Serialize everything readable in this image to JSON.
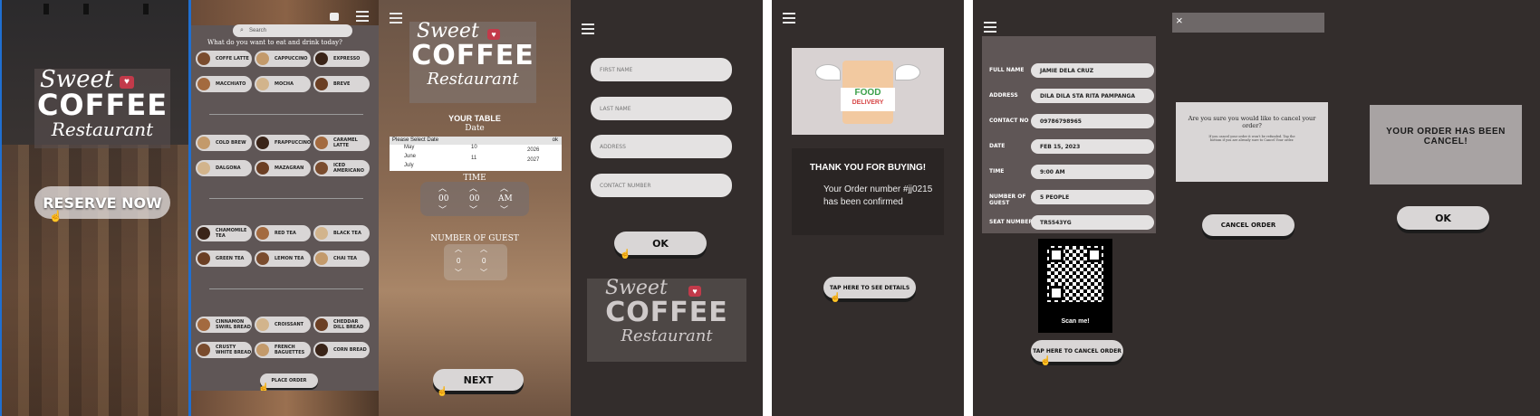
{
  "brand": {
    "script_top": "Sweet",
    "main": "COFFEE",
    "script_bottom": "Restaurant"
  },
  "screen1": {
    "reserve_label": "RESERVE NOW"
  },
  "screen2": {
    "search_placeholder": "Search",
    "prompt": "What do you want to eat and drink today?",
    "hot_drinks": [
      "COFFE LATTE",
      "CAPPUCCINO",
      "EXPRESSO",
      "MACCHIATO",
      "MOCHA",
      "BREVE"
    ],
    "cold_drinks": [
      "COLD BREW",
      "FRAPPUCCINO",
      "CARAMEL LATTE",
      "DALGONA",
      "MAZAGRAN",
      "ICED AMERICANO"
    ],
    "teas": [
      "CHAMOMILE TEA",
      "RED TEA",
      "BLACK TEA",
      "GREEN TEA",
      "LEMON TEA",
      "CHAI TEA"
    ],
    "breads": [
      "CINNAMON SWIRL BREAD",
      "CROISSANT",
      "CHEDDAR DILL BREAD",
      "CRUSTY WHITE BREAD",
      "FRENCH BAGUETTES",
      "CORN BREAD"
    ],
    "place_order": "PLACE ORDER"
  },
  "screen3": {
    "your_table": "YOUR TABLE",
    "date_label": "Date",
    "date_header": "Please Select Date",
    "date_ok": "ok",
    "months": [
      "May",
      "June",
      "July"
    ],
    "days": [
      "10",
      "11"
    ],
    "years": [
      "2026",
      "2027"
    ],
    "time_label": "TIME",
    "time_values": [
      "00",
      "00",
      "AM"
    ],
    "guest_label": "NUMBER OF GUEST",
    "guest_values": [
      "0",
      "0"
    ],
    "next_label": "NEXT"
  },
  "screen4": {
    "first_name": "FIRST NAME",
    "last_name": "LAST NAME",
    "address": "ADDRESS",
    "contact": "CONTACT NUMBER",
    "ok_label": "OK"
  },
  "screen5": {
    "badge_line1": "FOOD",
    "badge_line2": "DELIVERY",
    "thanks": "THANK YOU FOR BUYING!",
    "order_line1": "Your Order number #jj0215",
    "order_line2": "has been confirmed",
    "details_button": "TAP HERE TO SEE DETAILS"
  },
  "screen6": {
    "rows": [
      {
        "label": "FULL NAME",
        "value": "JAMIE DELA CRUZ"
      },
      {
        "label": "ADDRESS",
        "value": "DILA DILA STA RITA PAMPANGA"
      },
      {
        "label": "CONTACT NO",
        "value": "09786798965"
      },
      {
        "label": "DATE",
        "value": "FEB 15, 2023"
      },
      {
        "label": "TIME",
        "value": "9:00 AM"
      },
      {
        "label": "NUMBER OF GUEST",
        "value": "5 PEOPLE"
      },
      {
        "label": "SEAT NUMBER",
        "value": "TR5543YG"
      }
    ],
    "qr_caption": "Scan me!",
    "cancel_button": "TAP HERE TO CANCEL ORDER"
  },
  "screen7": {
    "close": "×",
    "question": "Are you sure you would like to cancel your order?",
    "fine_print": "If you cancel your order it won't be refunded. Tap the bottom if you are already sure to Cancel Your order.",
    "cancel_label": "CANCEL ORDER"
  },
  "screen8": {
    "message": "YOUR ORDER HAS BEEN CANCEL!",
    "ok_label": "OK"
  },
  "colors": {
    "dark_bg": "#332d2c",
    "panel": "#5f5656",
    "pill": "#d9d6d6",
    "accent_red": "#c23a4a",
    "selection_blue": "#1f6fd1"
  }
}
